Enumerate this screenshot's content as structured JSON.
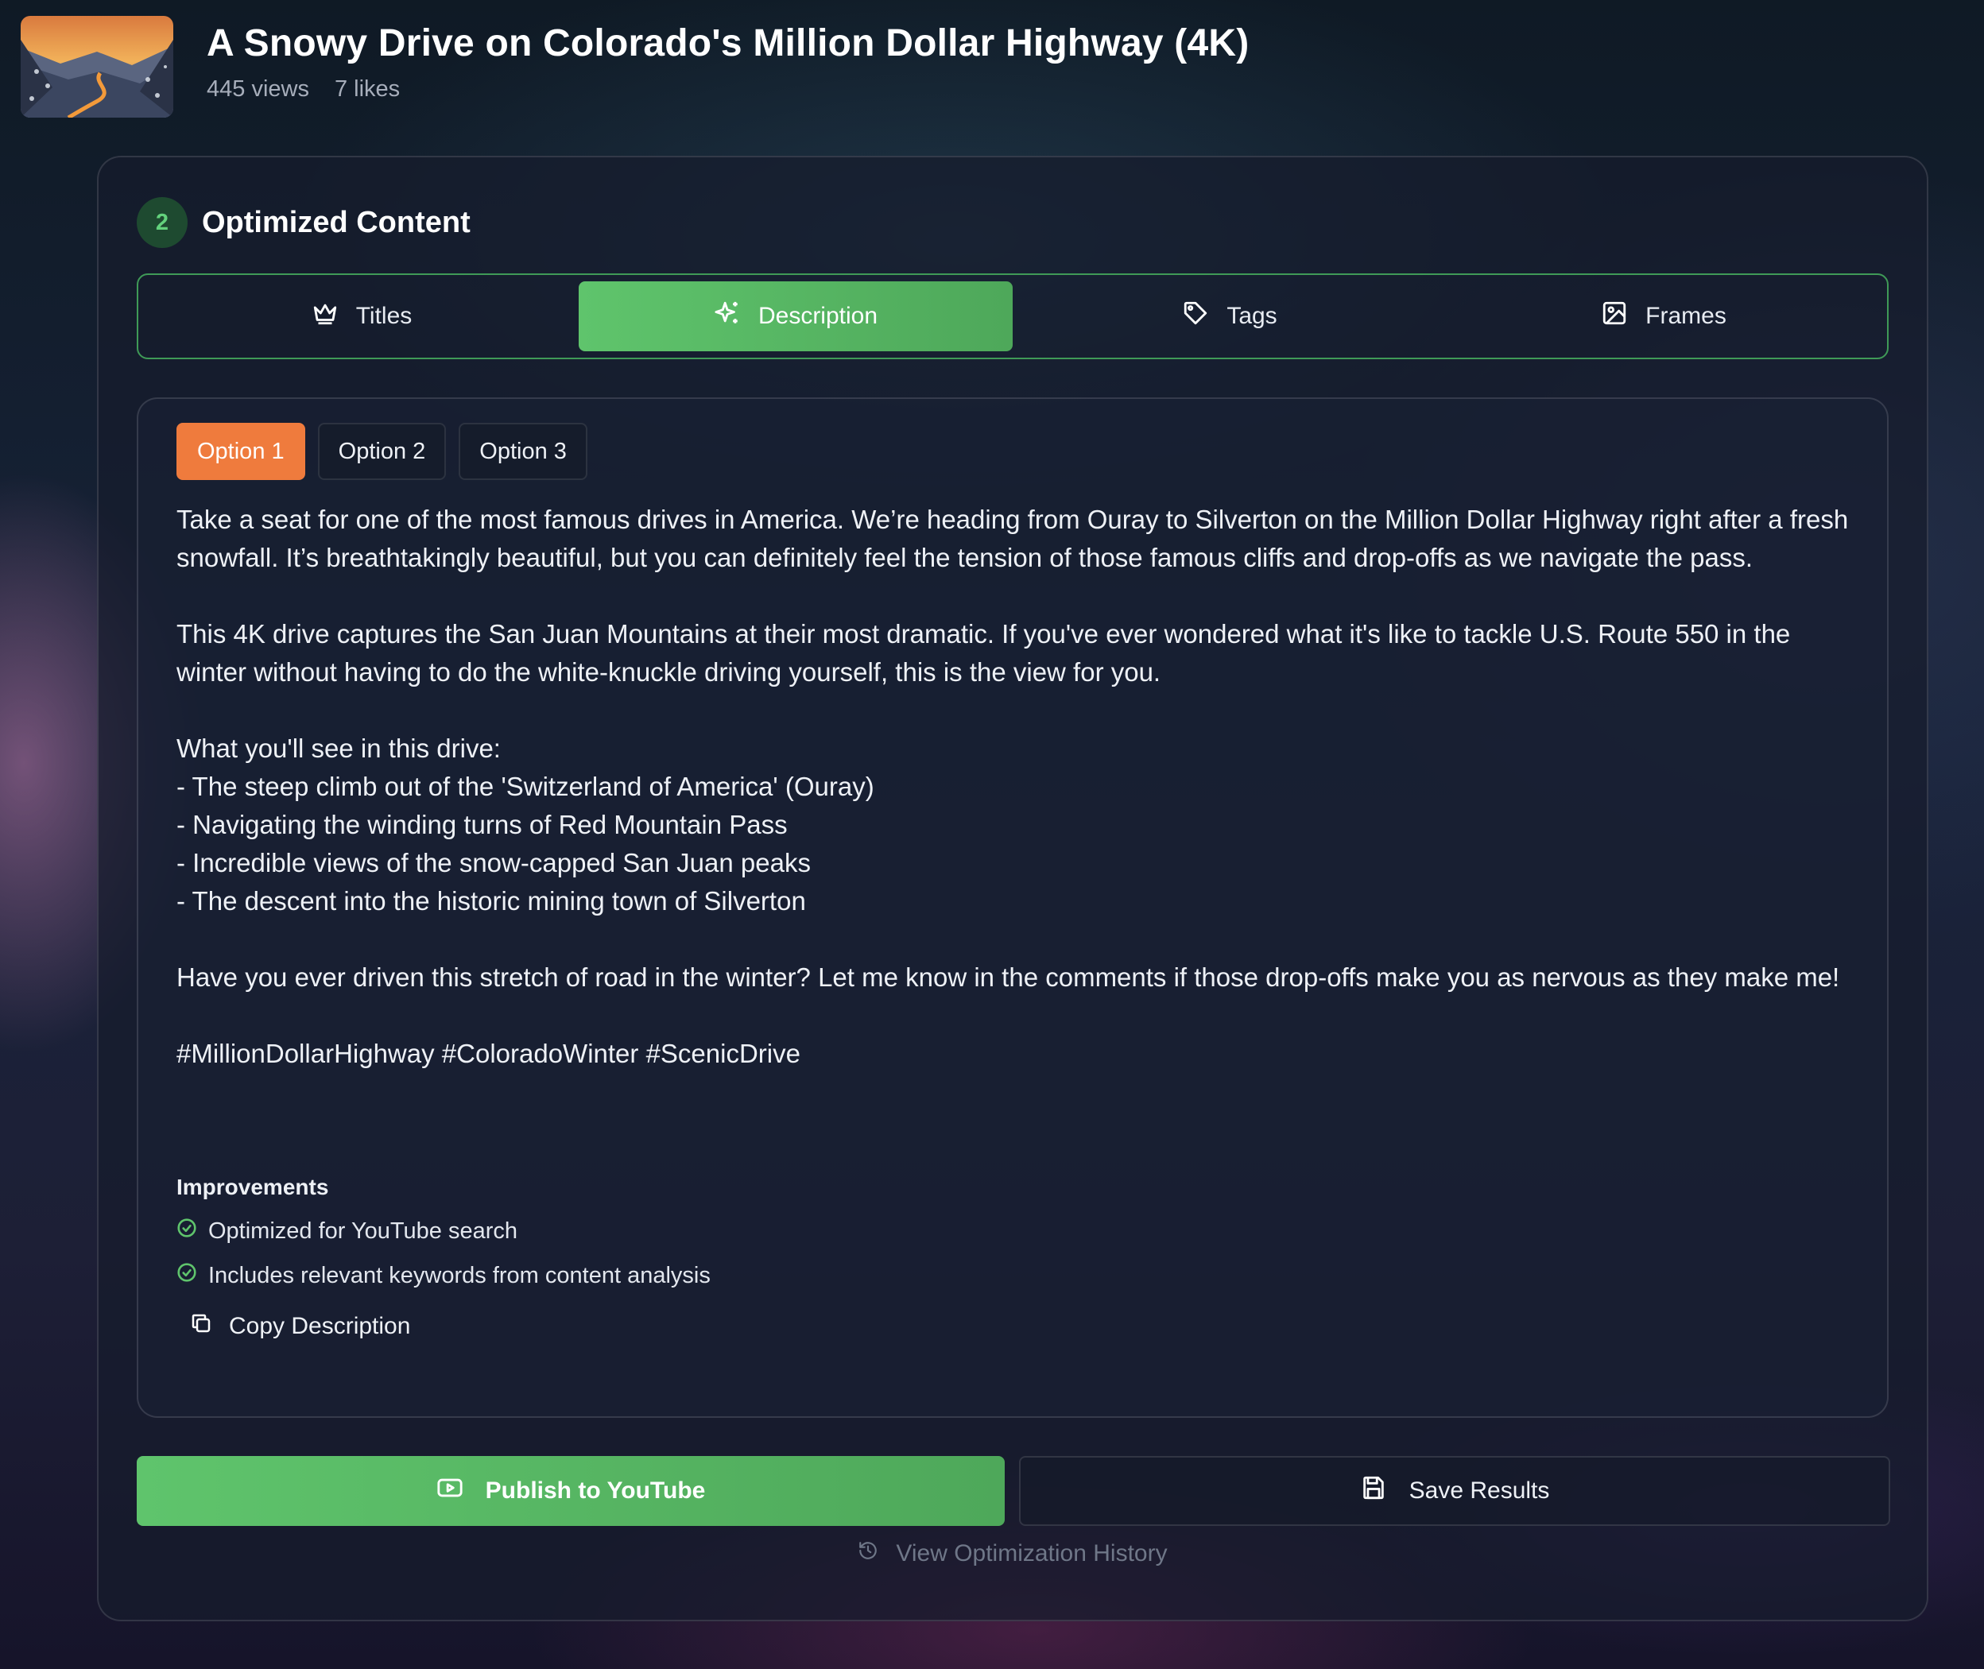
{
  "video": {
    "title": "A Snowy Drive on Colorado's Million Dollar Highway (4K)",
    "views": "445 views",
    "likes": "7 likes",
    "thumbnail_icon": "mountain-road-thumbnail"
  },
  "section": {
    "step": "2",
    "title": "Optimized Content"
  },
  "tabs": [
    {
      "label": "Titles",
      "icon": "crown-icon"
    },
    {
      "label": "Description",
      "icon": "sparkles-icon",
      "active": true
    },
    {
      "label": "Tags",
      "icon": "tag-icon"
    },
    {
      "label": "Frames",
      "icon": "image-icon"
    }
  ],
  "options": [
    {
      "label": "Option 1",
      "active": true
    },
    {
      "label": "Option 2"
    },
    {
      "label": "Option 3"
    }
  ],
  "description": {
    "p1": "Take a seat for one of the most famous drives in America. We’re heading from Ouray to Silverton on the Million Dollar Highway right after a fresh snowfall. It’s breathtakingly beautiful, but you can definitely feel the tension of those famous cliffs and drop-offs as we navigate the pass.",
    "p2": "This 4K drive captures the San Juan Mountains at their most dramatic. If you've ever wondered what it's like to tackle U.S. Route 550 in the winter without having to do the white-knuckle driving yourself, this is the view for you.",
    "list_intro": "What you'll see in this drive:",
    "list": [
      "- The steep climb out of the 'Switzerland of America' (Ouray)",
      "- Navigating the winding turns of Red Mountain Pass",
      "- Incredible views of the snow-capped San Juan peaks",
      "- The descent into the historic mining town of Silverton"
    ],
    "p3": "Have you ever driven this stretch of road in the winter? Let me know in the comments if those drop-offs make you as nervous as they make me!",
    "hashtags": "#MillionDollarHighway #ColoradoWinter #ScenicDrive"
  },
  "improvements": {
    "title": "Improvements",
    "items": [
      "Optimized for YouTube search",
      "Includes relevant keywords from content analysis"
    ]
  },
  "actions": {
    "copy": "Copy Description",
    "publish": "Publish to YouTube",
    "save": "Save Results",
    "history": "View Optimization History"
  },
  "colors": {
    "accent_green": "#5fc46c",
    "accent_orange": "#ef7b3d",
    "badge_bg": "#1e4a30"
  }
}
